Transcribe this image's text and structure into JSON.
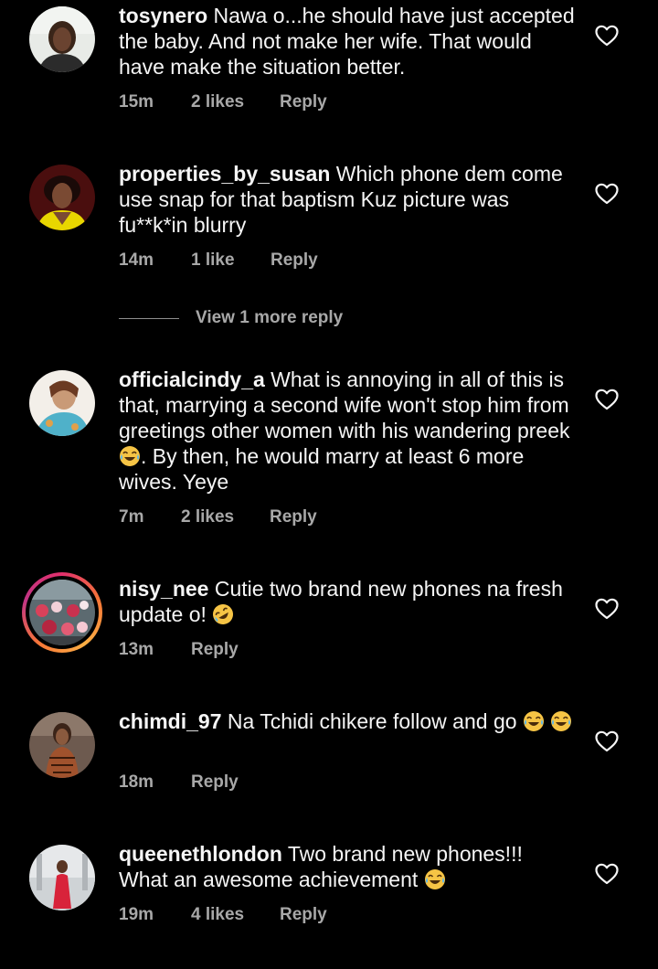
{
  "colors": {
    "background": "#000000",
    "text": "#f5f5f5",
    "meta": "#a8a8a8",
    "story_ring": "#e1306c"
  },
  "comments": [
    {
      "username": "tosynero",
      "text": "Nawa o...he should have just accepted the baby. And not make her wife. That would have make the situation better.",
      "time": "15m",
      "likes": "2 likes",
      "reply": "Reply"
    },
    {
      "username": "properties_by_susan",
      "text": "Which phone dem come use snap for that baptism Kuz picture was fu**k*in blurry",
      "time": "14m",
      "likes": "1 like",
      "reply": "Reply"
    },
    {
      "username": "officialcindy_a",
      "text_before": "What is annoying in all of this is that, marrying a second wife won't stop him from greetings other women with his wandering preek",
      "text_after": ". By then, he would marry at least 6 more wives. Yeye",
      "time": "7m",
      "likes": "2 likes",
      "reply": "Reply"
    },
    {
      "username": "nisy_nee",
      "text": "Cutie two brand new phones na fresh update o!",
      "time": "13m",
      "reply": "Reply"
    },
    {
      "username": "chimdi_97",
      "text": "Na Tchidi chikere follow and go",
      "time": "18m",
      "reply": "Reply"
    },
    {
      "username": "queenethlondon",
      "text": "Two brand new phones!!! What an awesome achievement",
      "time": "19m",
      "likes": "4 likes",
      "reply": "Reply"
    }
  ],
  "view_more_reply": "View 1 more reply",
  "icons": {
    "like": "heart-outline-icon",
    "laugh": "tears-of-joy-emoji",
    "rofl": "rolling-laughing-emoji"
  }
}
